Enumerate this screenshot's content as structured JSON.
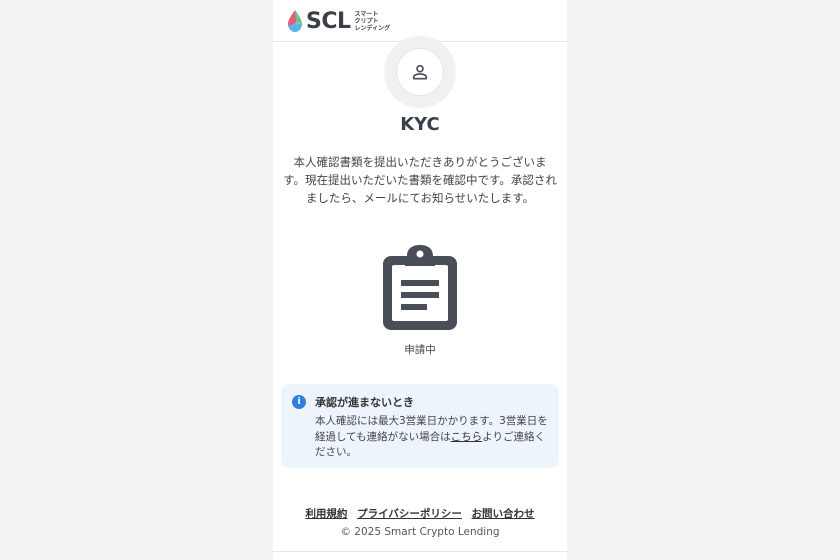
{
  "header": {
    "logo_text": "SCL",
    "logo_sub": [
      "スマート",
      "クリプト",
      "レンディング"
    ]
  },
  "kyc": {
    "title": "KYC",
    "message": "本人確認書類を提出いただきありがとうございます。現在提出いただいた書類を確認中です。承認されましたら、メールにてお知らせいたします。",
    "status": "申請中"
  },
  "notice": {
    "icon": "info-icon",
    "title": "承認が進まないとき",
    "body_before": "本人確認には最大3営業日かかります。3営業日を経過しても連絡がない場合は",
    "link": "こちら",
    "body_after": "よりご連絡ください。"
  },
  "footer": {
    "links": [
      "利用規約",
      "プライバシーポリシー",
      "お問い合わせ"
    ],
    "copyright": "© 2025 Smart Crypto Lending"
  },
  "colors": {
    "brand_dark": "#3b3f4a",
    "info_blue": "#2f7fe0",
    "notice_bg": "#eef4fb"
  }
}
